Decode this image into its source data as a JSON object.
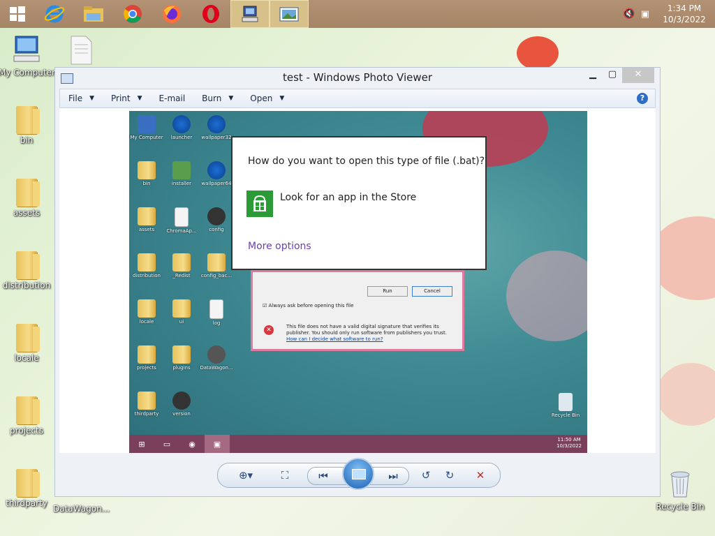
{
  "taskbar": {
    "buttons": [
      {
        "name": "start-button",
        "icon": "windows-logo-icon"
      },
      {
        "name": "internet-explorer-button",
        "icon": "internet-explorer-icon"
      },
      {
        "name": "file-explorer-button",
        "icon": "file-explorer-icon"
      },
      {
        "name": "chrome-button",
        "icon": "chrome-icon"
      },
      {
        "name": "firefox-button",
        "icon": "firefox-icon"
      },
      {
        "name": "opera-button",
        "icon": "opera-icon"
      },
      {
        "name": "computer-app-button",
        "icon": "computer-icon"
      },
      {
        "name": "photo-viewer-taskbar-button",
        "icon": "photo-viewer-icon"
      }
    ],
    "clock": {
      "time": "1:34 PM",
      "date": "10/3/2022"
    }
  },
  "desktop": {
    "icons": [
      {
        "label": "My Computer"
      },
      {
        "label": ""
      },
      {
        "label": "bin"
      },
      {
        "label": "assets"
      },
      {
        "label": "distribution"
      },
      {
        "label": "locale"
      },
      {
        "label": "projects"
      },
      {
        "label": "thirdparty"
      },
      {
        "label": "DataWagon..."
      },
      {
        "label": "Recycle Bin"
      }
    ]
  },
  "viewer": {
    "title": "test - Windows Photo Viewer",
    "menu": [
      {
        "label": "File"
      },
      {
        "label": "Print"
      },
      {
        "label": "E-mail"
      },
      {
        "label": "Burn"
      },
      {
        "label": "Open"
      }
    ],
    "help": "?"
  },
  "screenshot": {
    "icons": [
      {
        "label": "My Computer"
      },
      {
        "label": "launcher"
      },
      {
        "label": "wallpaper32"
      },
      {
        "label": "bin"
      },
      {
        "label": "installer"
      },
      {
        "label": "wallpaper64"
      },
      {
        "label": "assets"
      },
      {
        "label": "ChromaAp..."
      },
      {
        "label": "config"
      },
      {
        "label": "distribution"
      },
      {
        "label": "_Redist"
      },
      {
        "label": "config_bac..."
      },
      {
        "label": "locale"
      },
      {
        "label": "ui"
      },
      {
        "label": "log"
      },
      {
        "label": "projects"
      },
      {
        "label": "plugins"
      },
      {
        "label": "DataWagon..."
      },
      {
        "label": "thirdparty"
      },
      {
        "label": "version"
      },
      {
        "label": "Recycle Bin"
      }
    ],
    "clock": {
      "time": "11:50 AM",
      "date": "10/3/2022"
    },
    "security": {
      "run": "Run",
      "cancel": "Cancel",
      "always_ask": "Always ask before opening this file",
      "warning": "This file does not have a valid digital signature that verifies its publisher. You should only run software from publishers you trust.",
      "link": "How can I decide what software to run?"
    },
    "flyout": {
      "question": "How do you want to open this type of file (.bat)?",
      "store_option": "Look for an app in the Store",
      "more_options": "More options"
    }
  }
}
